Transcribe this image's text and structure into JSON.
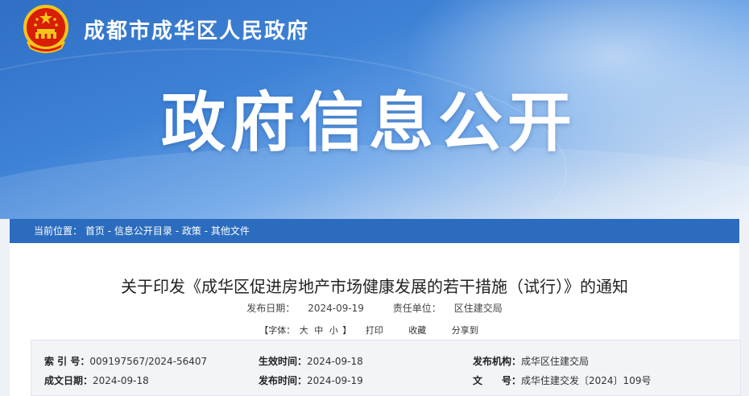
{
  "header": {
    "site_name": "成都市成华区人民政府",
    "section_title": "政府信息公开"
  },
  "breadcrumb": {
    "prefix": "当前位置：",
    "items": [
      "首页",
      "信息公开目录",
      "政策",
      "其他文件"
    ],
    "separator": " - "
  },
  "article": {
    "title": "关于印发《成华区促进房地产市场健康发展的若干措施（试行）》的通知",
    "publish_date_label": "发布日期：",
    "publish_date": "2024-09-19",
    "unit_label": "责任单位：",
    "unit": "区住建交局"
  },
  "tools": {
    "font_prefix": "【字体：",
    "font_large": "大",
    "font_medium": "中",
    "font_small": "小",
    "font_suffix": "】",
    "print": "打印",
    "favorite": "收藏",
    "share": "分享到"
  },
  "info": {
    "index_label": "索 引 号：",
    "index_value": "009197567/2024-56407",
    "effective_label": "生效时间：",
    "effective_value": "2024-09-18",
    "issuer_label": "发布机构：",
    "issuer_value": "成华区住建交局",
    "written_label": "成文日期：",
    "written_value": "2024-09-18",
    "published_label": "发布时间：",
    "published_value": "2024-09-19",
    "docno_label": "文　　号：",
    "docno_value": "成华住建交发〔2024〕109号"
  },
  "colors": {
    "banner_blue": "#2f6fc4",
    "breadcrumb_bar": "#2b6cbf",
    "emblem_red": "#d81e06",
    "emblem_gold": "#f5c518"
  }
}
